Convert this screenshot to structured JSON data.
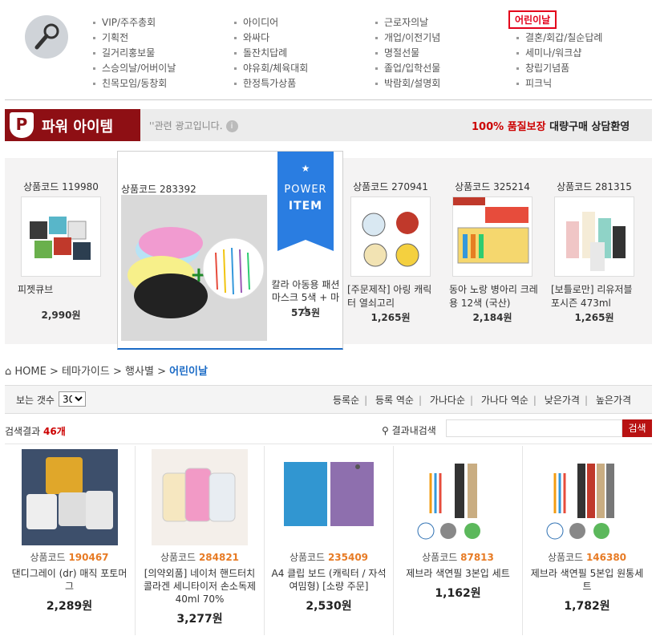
{
  "top_menu": {
    "icon": "microphone-icon",
    "columns": [
      [
        "VIP/주주총회",
        "기획전",
        "길거리홍보물",
        "스승의날/어버이날",
        "친목모임/동창회"
      ],
      [
        "아이디어",
        "와싸다",
        "돌잔치답례",
        "야유회/체육대회",
        "한정특가상품"
      ],
      [
        "근로자의날",
        "개업/이전기념",
        "명절선물",
        "졸업/입학선물",
        "박람회/설명회"
      ],
      [
        "어린이날",
        "결혼/회갑/칠순답례",
        "세미나/워크샵",
        "창립기념품",
        "피크닉"
      ]
    ]
  },
  "banner": {
    "logo_letter": "P",
    "title": "파워 아이템",
    "ad_note": "''관련 광고입니다.",
    "info_icon": "i",
    "quality_red": "100% 품질보장",
    "quality_black": "대량구매 상담환영"
  },
  "power_items": [
    {
      "code": "상품코드 119980",
      "name": "피젯큐브",
      "price": "2,990원"
    },
    {
      "code": "상품코드 270941",
      "name": "[주문제작] 아링 캐릭터 열쇠고리",
      "price": "1,265원"
    },
    {
      "code": "상품코드 325214",
      "name": "동아 노랑 병아리 크레용 12색 (국산)",
      "price": "2,184원"
    },
    {
      "code": "상품코드 281315",
      "name": "[보틀로만] 리유저블 포시즌 473ml",
      "price": "1,265원"
    }
  ],
  "featured": {
    "code": "상품코드 283392",
    "name": "칼라 아동용 패션 마스크 5색 + 마스",
    "price": "575원",
    "ribbon_star": "★",
    "ribbon_line1": "POWER",
    "ribbon_line2": "ITEM"
  },
  "breadcrumb": {
    "home": "HOME",
    "sep": ">",
    "l1": "테마가이드",
    "l2": "행사별",
    "current": "어린이날"
  },
  "toolbar": {
    "count_label": "보는 갯수",
    "count_value": "30",
    "sorts": [
      "등록순",
      "등록 역순",
      "가나다순",
      "가나다 역순",
      "낮은가격",
      "높은가격"
    ]
  },
  "results": {
    "label": "검색결과",
    "count": "46개",
    "search_label": "결과내검색",
    "search_button": "검색"
  },
  "products": [
    {
      "code_label": "상품코드",
      "code": "190467",
      "name": "댄디그레이 (dr) 매직 포토머그",
      "price": "2,289원"
    },
    {
      "code_label": "상품코드",
      "code": "284821",
      "name": "[의약외품] 네이처 핸드터치 콜라겐 세니타이저 손소독제 40ml 70%",
      "price": "3,277원"
    },
    {
      "code_label": "상품코드",
      "code": "235409",
      "name": "A4 클립 보드 (캐릭터 / 자석 여밈형) [소량 주문]",
      "price": "2,530원"
    },
    {
      "code_label": "상품코드",
      "code": "87813",
      "name": "제브라 색연필 3본입 세트",
      "price": "1,162원"
    },
    {
      "code_label": "상품코드",
      "code": "146380",
      "name": "제브라 색연필 5본입 원통세트",
      "price": "1,782원"
    }
  ],
  "colors": {
    "accent_red": "#e3001b",
    "link_blue": "#1b6bc6",
    "code_orange": "#e77b25",
    "banner_maroon": "#8e0f14",
    "ribbon_blue": "#2a7de1"
  }
}
